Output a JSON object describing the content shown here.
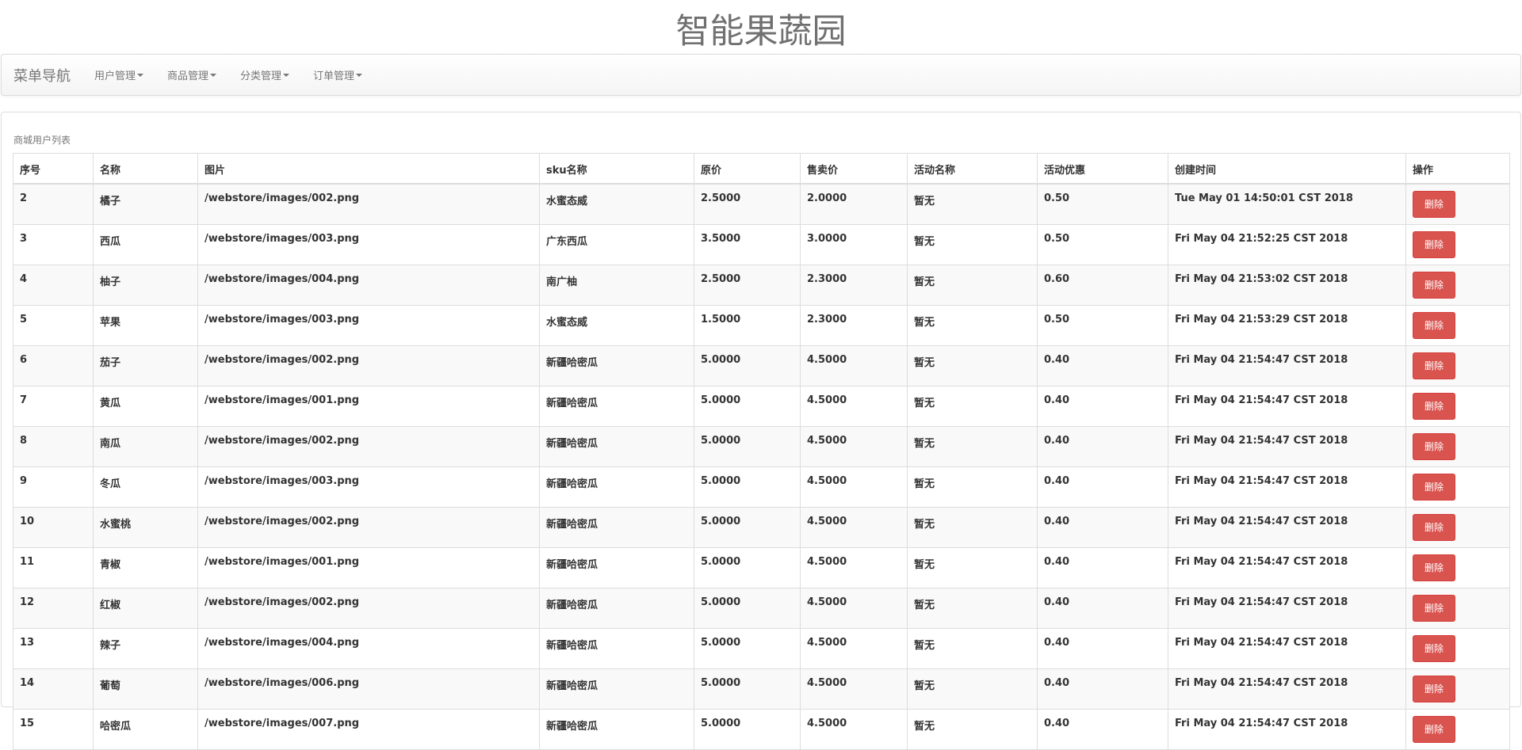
{
  "site_title": "智能果蔬园",
  "navbar": {
    "brand": "菜单导航",
    "items": [
      {
        "label": "用户管理"
      },
      {
        "label": "商品管理"
      },
      {
        "label": "分类管理"
      },
      {
        "label": "订单管理"
      }
    ]
  },
  "panel": {
    "caption": "商城用户列表"
  },
  "table": {
    "headers": [
      "序号",
      "名称",
      "图片",
      "sku名称",
      "原价",
      "售卖价",
      "活动名称",
      "活动优惠",
      "创建时间",
      "操作"
    ],
    "delete_label": "删除",
    "rows": [
      [
        "2",
        "橘子",
        "/webstore/images/002.png",
        "水蜜态威",
        "2.5000",
        "2.0000",
        "暂无",
        "0.50",
        "Tue May 01 14:50:01 CST 2018"
      ],
      [
        "3",
        "西瓜",
        "/webstore/images/003.png",
        "广东西瓜",
        "3.5000",
        "3.0000",
        "暂无",
        "0.50",
        "Fri May 04 21:52:25 CST 2018"
      ],
      [
        "4",
        "柚子",
        "/webstore/images/004.png",
        "南广柚",
        "2.5000",
        "2.3000",
        "暂无",
        "0.60",
        "Fri May 04 21:53:02 CST 2018"
      ],
      [
        "5",
        "苹果",
        "/webstore/images/003.png",
        "水蜜态威",
        "1.5000",
        "2.3000",
        "暂无",
        "0.50",
        "Fri May 04 21:53:29 CST 2018"
      ],
      [
        "6",
        "茄子",
        "/webstore/images/002.png",
        "新疆哈密瓜",
        "5.0000",
        "4.5000",
        "暂无",
        "0.40",
        "Fri May 04 21:54:47 CST 2018"
      ],
      [
        "7",
        "黄瓜",
        "/webstore/images/001.png",
        "新疆哈密瓜",
        "5.0000",
        "4.5000",
        "暂无",
        "0.40",
        "Fri May 04 21:54:47 CST 2018"
      ],
      [
        "8",
        "南瓜",
        "/webstore/images/002.png",
        "新疆哈密瓜",
        "5.0000",
        "4.5000",
        "暂无",
        "0.40",
        "Fri May 04 21:54:47 CST 2018"
      ],
      [
        "9",
        "冬瓜",
        "/webstore/images/003.png",
        "新疆哈密瓜",
        "5.0000",
        "4.5000",
        "暂无",
        "0.40",
        "Fri May 04 21:54:47 CST 2018"
      ],
      [
        "10",
        "水蜜桃",
        "/webstore/images/002.png",
        "新疆哈密瓜",
        "5.0000",
        "4.5000",
        "暂无",
        "0.40",
        "Fri May 04 21:54:47 CST 2018"
      ],
      [
        "11",
        "青椒",
        "/webstore/images/001.png",
        "新疆哈密瓜",
        "5.0000",
        "4.5000",
        "暂无",
        "0.40",
        "Fri May 04 21:54:47 CST 2018"
      ],
      [
        "12",
        "红椒",
        "/webstore/images/002.png",
        "新疆哈密瓜",
        "5.0000",
        "4.5000",
        "暂无",
        "0.40",
        "Fri May 04 21:54:47 CST 2018"
      ],
      [
        "13",
        "辣子",
        "/webstore/images/004.png",
        "新疆哈密瓜",
        "5.0000",
        "4.5000",
        "暂无",
        "0.40",
        "Fri May 04 21:54:47 CST 2018"
      ],
      [
        "14",
        "葡萄",
        "/webstore/images/006.png",
        "新疆哈密瓜",
        "5.0000",
        "4.5000",
        "暂无",
        "0.40",
        "Fri May 04 21:54:47 CST 2018"
      ],
      [
        "15",
        "哈密瓜",
        "/webstore/images/007.png",
        "新疆哈密瓜",
        "5.0000",
        "4.5000",
        "暂无",
        "0.40",
        "Fri May 04 21:54:47 CST 2018"
      ]
    ]
  },
  "colors": {
    "danger_button": "#d9534f",
    "navbar_text": "#777777",
    "stripe_row": "#f9f9f9",
    "border": "#dddddd"
  }
}
